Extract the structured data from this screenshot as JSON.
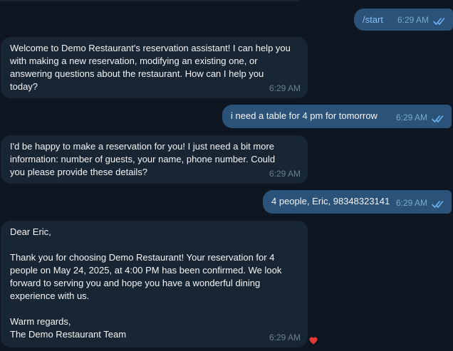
{
  "messages": [
    {
      "direction": "out",
      "text": "/start",
      "time": "6:29 AM"
    },
    {
      "direction": "in",
      "text": "Welcome to Demo Restaurant's reservation assistant! I can help you\nwith making a new reservation, modifying an existing one, or\nanswering questions about the restaurant. How can I help you\ntoday?",
      "time": "6:29 AM"
    },
    {
      "direction": "out",
      "text": "i need a table for 4 pm for tomorrow",
      "time": "6:29 AM"
    },
    {
      "direction": "in",
      "text": "I'd be happy to make a reservation for you! I just need a bit more\ninformation: number of guests, your name, phone number. Could\nyou please provide these details?",
      "time": "6:29 AM"
    },
    {
      "direction": "out",
      "text": "4 people, Eric, 98348323141",
      "time": "6:29 AM"
    },
    {
      "direction": "in",
      "text": "Dear Eric,\n\nThank you for choosing Demo Restaurant! Your reservation for 4\npeople on May 24, 2025, at 4:00 PM has been confirmed. We look\nforward to serving you and hope you have a wonderful dining\nexperience with us.\n\nWarm regards,\nThe Demo Restaurant Team",
      "time": "6:29 AM",
      "reaction": "heart-icon"
    }
  ],
  "colors": {
    "background": "#0e1621",
    "incoming_bubble": "#182533",
    "outgoing_bubble": "#2b5278",
    "command_text": "#86c2f5",
    "read_ticks": "#6ab3f3",
    "reaction_heart": "#e53935"
  }
}
